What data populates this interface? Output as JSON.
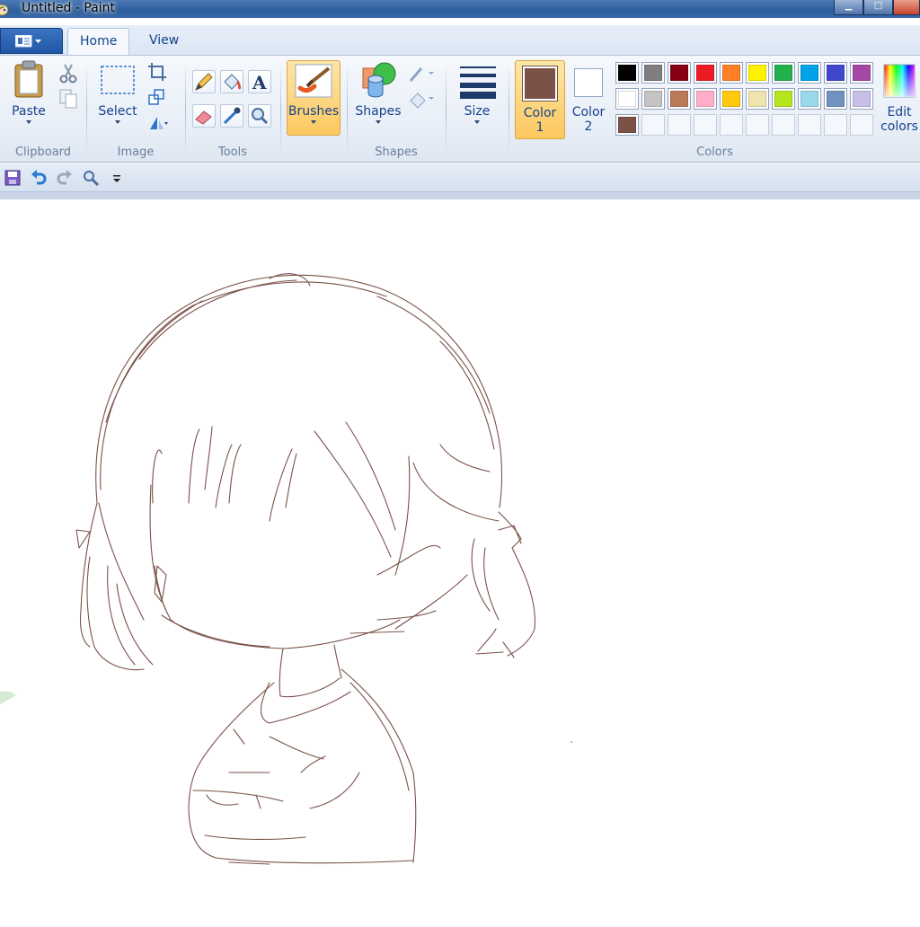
{
  "window": {
    "title": "Untitled - Paint",
    "controls": [
      "minimize",
      "maximize",
      "close"
    ]
  },
  "tabs": [
    {
      "label": "Home",
      "active": true
    },
    {
      "label": "View",
      "active": false
    }
  ],
  "ribbon": {
    "clipboard": {
      "group_label": "Clipboard",
      "paste_label": "Paste",
      "icons": [
        "cut-icon",
        "copy-icon"
      ]
    },
    "image": {
      "group_label": "Image",
      "select_label": "Select",
      "icons": [
        "crop-icon",
        "resize-icon",
        "rotate-icon"
      ]
    },
    "tools": {
      "group_label": "Tools",
      "icons": [
        "pencil-icon",
        "fill-icon",
        "text-icon",
        "eraser-icon",
        "color-picker-icon",
        "magnifier-icon"
      ]
    },
    "brushes": {
      "label": "Brushes",
      "active": true
    },
    "shapes": {
      "group_label": "Shapes",
      "shapes_label": "Shapes",
      "icons": [
        "outline-icon",
        "fill-shape-icon"
      ]
    },
    "size": {
      "label": "Size"
    },
    "colors": {
      "group_label": "Colors",
      "color1_label": "Color",
      "color1_num": "1",
      "color2_label": "Color",
      "color2_num": "2",
      "color1_value": "#7a5248",
      "color2_value": "#ffffff",
      "edit_label_line1": "Edit",
      "edit_label_line2": "colors",
      "palette_row1": [
        "#000000",
        "#7f7f7f",
        "#880015",
        "#ed1c24",
        "#ff7f27",
        "#fff200",
        "#22b14c",
        "#00a2e8",
        "#3f48cc",
        "#a349a4"
      ],
      "palette_row2": [
        "#ffffff",
        "#c3c3c3",
        "#b97a57",
        "#ffaec9",
        "#ffc90e",
        "#efe4b0",
        "#b5e61d",
        "#99d9ea",
        "#7092be",
        "#c8bfe7"
      ],
      "palette_row3": [
        "#7a5248",
        "",
        "",
        "",
        "",
        "",
        "",
        "",
        "",
        ""
      ]
    }
  },
  "quick_access": [
    "save-icon",
    "undo-icon",
    "redo-icon",
    "zoom-icon",
    "customize-icon"
  ],
  "canvas": {
    "stroke_color": "#7a5248"
  }
}
